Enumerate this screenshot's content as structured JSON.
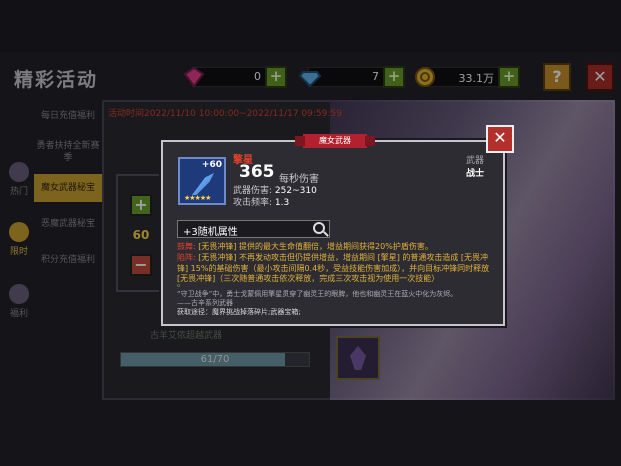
{
  "header": {
    "title": "精彩活动",
    "resources": [
      {
        "icon": "pink-gem-icon",
        "value": "0"
      },
      {
        "icon": "blue-diamond-icon",
        "value": "7"
      },
      {
        "icon": "gold-coin-icon",
        "value": "33.1万"
      }
    ],
    "help": "?",
    "close": "✕"
  },
  "sidebar": {
    "tabs": [
      "每日充值福利",
      "勇者扶持全新赛季",
      "魔女武器秘宝",
      "恶魔武器秘宝",
      "积分充值福利"
    ],
    "active_index": 2,
    "icons": [
      {
        "label": "热门",
        "icon": "hot-icon"
      },
      {
        "label": "限时",
        "icon": "clock-icon"
      },
      {
        "label": "福利",
        "icon": "gift-icon"
      }
    ]
  },
  "activity": {
    "time": "活动时间2022/11/10 10:00:00~2022/11/17 09:59:59",
    "stepper_value": "60",
    "progress_text": "61/70",
    "progress_fraction": 0.87,
    "background_line": "古羊艾侬超越武器"
  },
  "popup": {
    "banner": "魔女武器",
    "close": "✕",
    "weapon": {
      "level": "+60",
      "stars": "★★★★★",
      "name": "擎星",
      "damage": "365",
      "damage_label": "每秒伤害",
      "weapon_damage_label": "武器伤害:",
      "weapon_damage": "252~310",
      "attack_rate_label": "攻击频率:",
      "attack_rate": "1.3",
      "type_label": "武器",
      "type": "战士"
    },
    "attr_label": "+3随机属性",
    "effects": [
      {
        "key": "鼓舞:",
        "text": "[无畏冲锋] 提供的最大生命值翻倍，增益期间获得20%护盾伤害。",
        "color": "yellow"
      },
      {
        "key": "陷阵:",
        "text": "[无畏冲锋] 不再发动攻击但仍提供增益，增益期间 [擎星] 的普通攻击造成 [无畏冲锋] 15%的基础伤害（最小攻击间隔0.4秒，受益技能伤害加成），并向目标冲锋同时释放 [无畏冲锋]（三次随普通攻击依次释放，完成三次攻击视为使用一次技能）",
        "color": "yellow"
      },
      {
        "key": "",
        "text": "。",
        "color": "green"
      }
    ],
    "lore": [
      "“守卫战争”中，勇士戈蒙佩用擎星贯穿了幽灵王的眼脾，他也和幽灵王在蓝火中化为灰烬。",
      "——古辛系列武器",
      "获取途径：魔界挑战掉落碎片;武器宝箱;"
    ]
  }
}
